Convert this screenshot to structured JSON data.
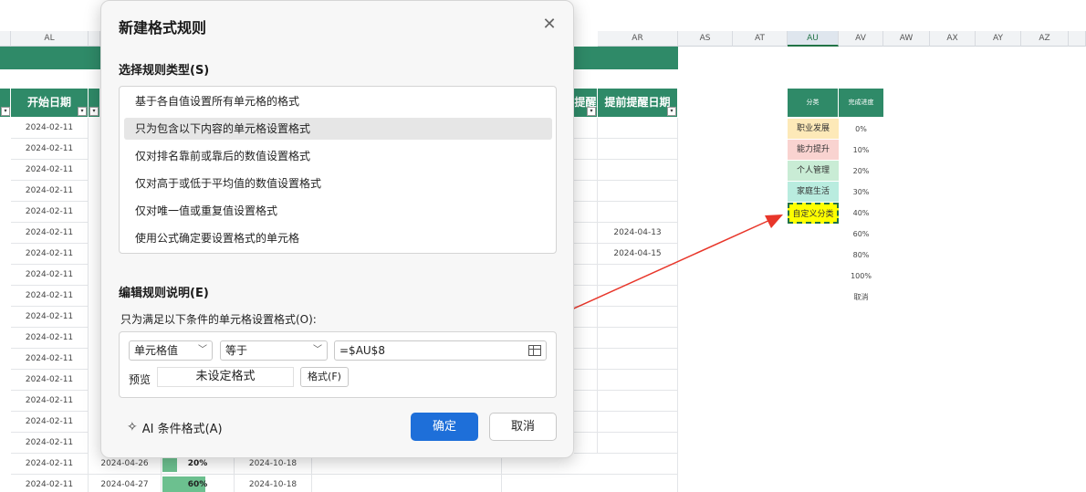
{
  "sheet": {
    "col_headers": {
      "al": "AL",
      "ar": "AR",
      "as": "AS",
      "at": "AT",
      "au": "AU",
      "av": "AV",
      "aw": "AW",
      "ax": "AX",
      "ay": "AY",
      "az": "AZ"
    },
    "table_headers": {
      "start_date": "开始日期",
      "remind_partial": "提醒",
      "advance_remind_date": "提前提醒日期"
    },
    "start_dates": [
      "2024-02-11",
      "2024-02-11",
      "2024-02-11",
      "2024-02-11",
      "2024-02-11",
      "2024-02-11",
      "2024-02-11",
      "2024-02-11",
      "2024-02-11",
      "2024-02-11",
      "2024-02-11",
      "2024-02-11",
      "2024-02-11",
      "2024-02-11",
      "2024-02-11",
      "2024-02-11",
      "2024-02-11",
      "2024-02-11"
    ],
    "advance_dates": {
      "row6": "2024-04-13",
      "row7": "2024-04-15"
    },
    "bottom_rows": [
      {
        "start": "2024-02-11",
        "date2": "2024-04-26",
        "pct": "20%",
        "pct_value": 0.2,
        "date3": "2024-10-18"
      },
      {
        "start": "2024-02-11",
        "date2": "2024-04-27",
        "pct": "60%",
        "pct_value": 0.6,
        "date3": "2024-10-18"
      }
    ],
    "category": {
      "header": "分类",
      "items": [
        {
          "label": "职业发展",
          "color": "#fde9b8"
        },
        {
          "label": "能力提升",
          "color": "#f9d3d0"
        },
        {
          "label": "个人管理",
          "color": "#c9ecd5"
        },
        {
          "label": "家庭生活",
          "color": "#b9ecdf"
        },
        {
          "label": "自定义分类",
          "color": "#ffff00"
        }
      ]
    },
    "progress": {
      "header": "完成进度",
      "items": [
        "0%",
        "10%",
        "20%",
        "30%",
        "40%",
        "60%",
        "80%",
        "100%",
        "取消"
      ]
    }
  },
  "dialog": {
    "title": "新建格式规则",
    "section_type": "选择规则类型(S)",
    "rule_types": [
      "基于各自值设置所有单元格的格式",
      "只为包含以下内容的单元格设置格式",
      "仅对排名靠前或靠后的数值设置格式",
      "仅对高于或低于平均值的数值设置格式",
      "仅对唯一值或重复值设置格式",
      "使用公式确定要设置格式的单元格"
    ],
    "selected_index": 1,
    "section_edit": "编辑规则说明(E)",
    "condition_label": "只为满足以下条件的单元格设置格式(O):",
    "dropdown1": "单元格值",
    "dropdown2": "等于",
    "value_field": "=$AU$8",
    "preview_label": "预览",
    "preview_text": "未设定格式",
    "format_button": "格式(F)",
    "ai_label": "AI 条件格式(A)",
    "ok": "确定",
    "cancel": "取消"
  },
  "colors": {
    "header_green": "#2f8a68",
    "ok_blue": "#1e6fd9",
    "arrow_red": "#e8362a"
  }
}
